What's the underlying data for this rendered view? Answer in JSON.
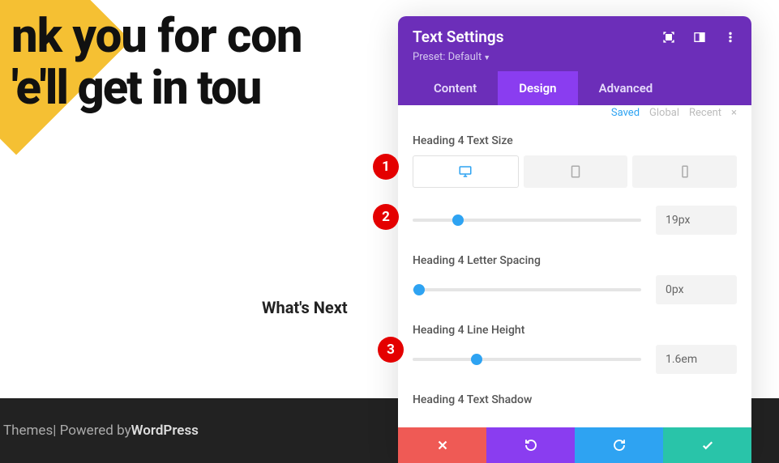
{
  "hero": {
    "line1": "nk you for co",
    "line1_suffix": "n",
    "line2": "'e'll get in tou"
  },
  "whats_next": "What's Next",
  "footer": {
    "brand": "Themes",
    "sep": " | Powered by ",
    "engine": "WordPress"
  },
  "panel": {
    "title": "Text Settings",
    "preset_label": "Preset: Default",
    "tabs": {
      "content": "Content",
      "design": "Design",
      "advanced": "Advanced"
    },
    "hints": {
      "saved": "Saved",
      "global": "Global",
      "recent": "Recent"
    }
  },
  "settings": {
    "text_size": {
      "label": "Heading 4 Text Size",
      "value": "19px",
      "pct": 20
    },
    "letter_spacing": {
      "label": "Heading 4 Letter Spacing",
      "value": "0px",
      "pct": 3
    },
    "line_height": {
      "label": "Heading 4 Line Height",
      "value": "1.6em",
      "pct": 28
    },
    "text_shadow": {
      "label": "Heading 4 Text Shadow"
    }
  },
  "markers": {
    "m1": "1",
    "m2": "2",
    "m3": "3"
  }
}
